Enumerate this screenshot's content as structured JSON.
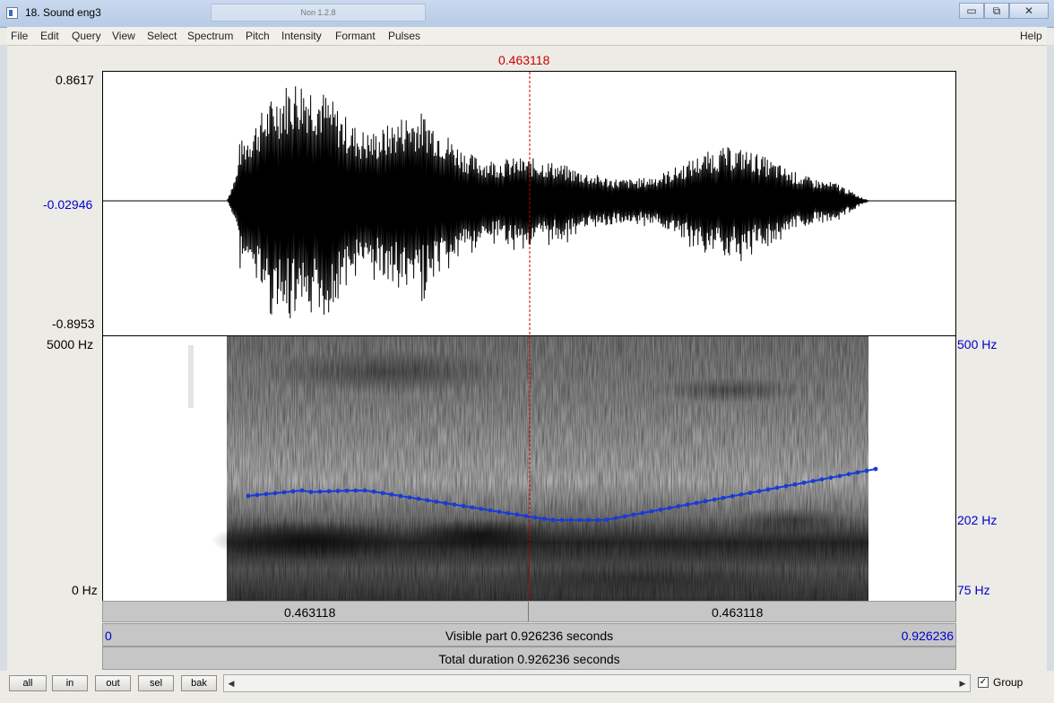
{
  "window": {
    "title": "18. Sound eng3",
    "background_tab": "Non 1.2.8"
  },
  "menu": [
    "File",
    "Edit",
    "Query",
    "View",
    "Select",
    "Spectrum",
    "Pitch",
    "Intensity",
    "Formant",
    "Pulses"
  ],
  "menu_help": "Help",
  "cursor": {
    "time_label": "0.463118"
  },
  "waveform": {
    "max_label": "0.8617",
    "zero_label": "-0.02946",
    "min_label": "-0.8953"
  },
  "spectrogram": {
    "top_label": "5000 Hz",
    "bottom_label": "0 Hz"
  },
  "pitch_axis": {
    "top_label": "500 Hz",
    "mid_label": "202 Hz",
    "bottom_label": "75 Hz"
  },
  "selection_bar": {
    "left_label": "0.463118",
    "right_label": "0.463118"
  },
  "visible_bar": {
    "start": "0",
    "text": "Visible part 0.926236 seconds",
    "end": "0.926236"
  },
  "total_bar": {
    "text": "Total duration 0.926236 seconds"
  },
  "buttons": {
    "all": "all",
    "in": "in",
    "out": "out",
    "sel": "sel",
    "bak": "bak"
  },
  "group": {
    "label": "Group",
    "checked_mark": "✓"
  },
  "colors": {
    "pitch": "#1a3bd6",
    "cursor": "#cc0000",
    "axis_blue": "#0000cc"
  }
}
